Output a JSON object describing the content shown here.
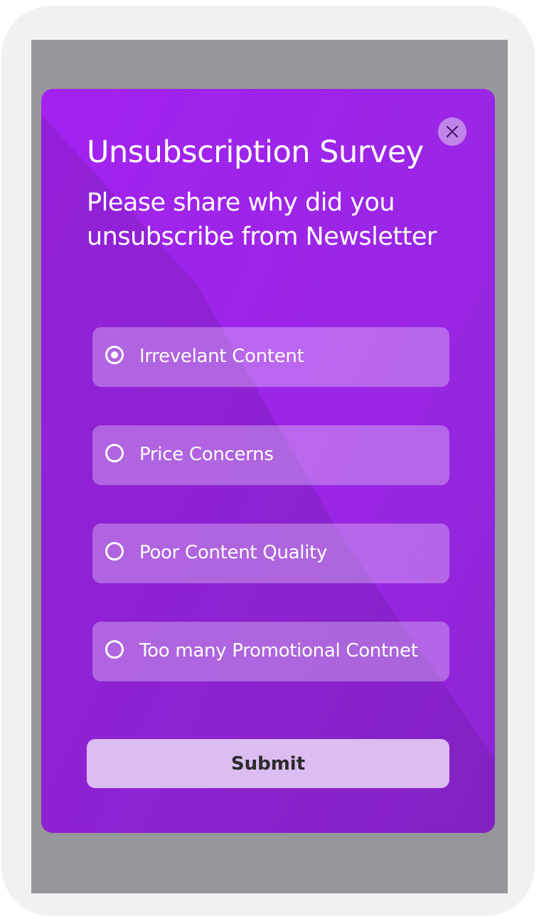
{
  "survey": {
    "title": "Unsubscription Survey",
    "subtitle": "Please share why did you unsubscribe from Newsletter",
    "close_icon": "close-icon",
    "options": [
      {
        "label": "Irrevelant Content",
        "selected": true
      },
      {
        "label": "Price Concerns",
        "selected": false
      },
      {
        "label": "Poor Content Quality",
        "selected": false
      },
      {
        "label": "Too many Promotional Contnet",
        "selected": false
      }
    ],
    "submit_label": "Submit"
  },
  "colors": {
    "modal_accent": "#9b26e6",
    "backdrop": "#95979b",
    "submit_bg": "#dcbdf1",
    "close_bg": "#c184ea"
  }
}
